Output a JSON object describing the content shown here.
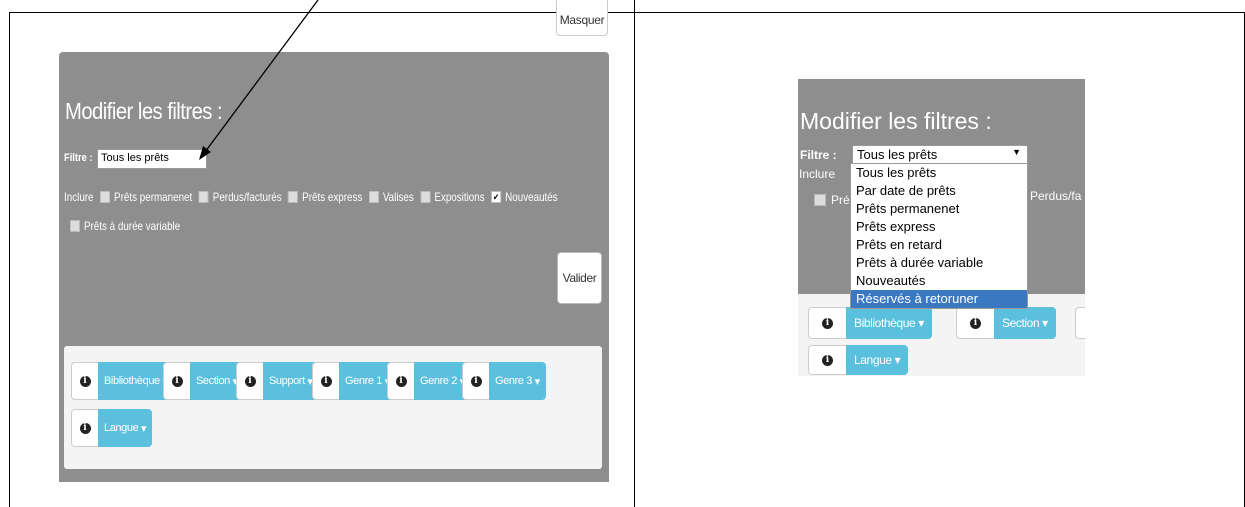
{
  "left": {
    "masquer_label": "Masquer",
    "title": "Modifier les filtres :",
    "filtre_label": "Filtre :",
    "filtre_value": "Tous les prêts",
    "inclure_label": "Inclure",
    "checkboxes": [
      {
        "label": "Prêts permanenet",
        "checked": false
      },
      {
        "label": "Perdus/facturés",
        "checked": false
      },
      {
        "label": "Prêts express",
        "checked": false
      },
      {
        "label": "Valises",
        "checked": false
      },
      {
        "label": "Expositions",
        "checked": false
      },
      {
        "label": "Nouveautés",
        "checked": true
      },
      {
        "label": "Prêts à durée variable",
        "checked": false
      }
    ],
    "valider_label": "Valider",
    "facets": [
      "Bibliothèque",
      "Section",
      "Support",
      "Genre 1",
      "Genre 2",
      "Genre 3",
      "Langue"
    ]
  },
  "right": {
    "title": "Modifier les filtres :",
    "filtre_label": "Filtre :",
    "select_value": "Tous les prêts",
    "inclure_label": "Inclure",
    "perdus_partial": "Perdus/fa",
    "pre_partial": "Pré",
    "options": [
      "Tous les prêts",
      "Par date de prêts",
      "Prêts permanenet",
      "Prêts express",
      "Prêts en retard",
      "Prêts à durée variable",
      "Nouveautés",
      "Réservés à retoruner"
    ],
    "selected_option": "Réservés à retoruner",
    "facets": [
      "Bibliothèque",
      "Section",
      "Langue"
    ]
  },
  "colors": {
    "panel": "#8e8e8e",
    "facet_button": "#5bc0de",
    "selected_option": "#3b78c2"
  },
  "icons": {
    "info": "info-circle-icon",
    "caret": "caret-down-icon",
    "arrow": "annotation-arrow"
  }
}
